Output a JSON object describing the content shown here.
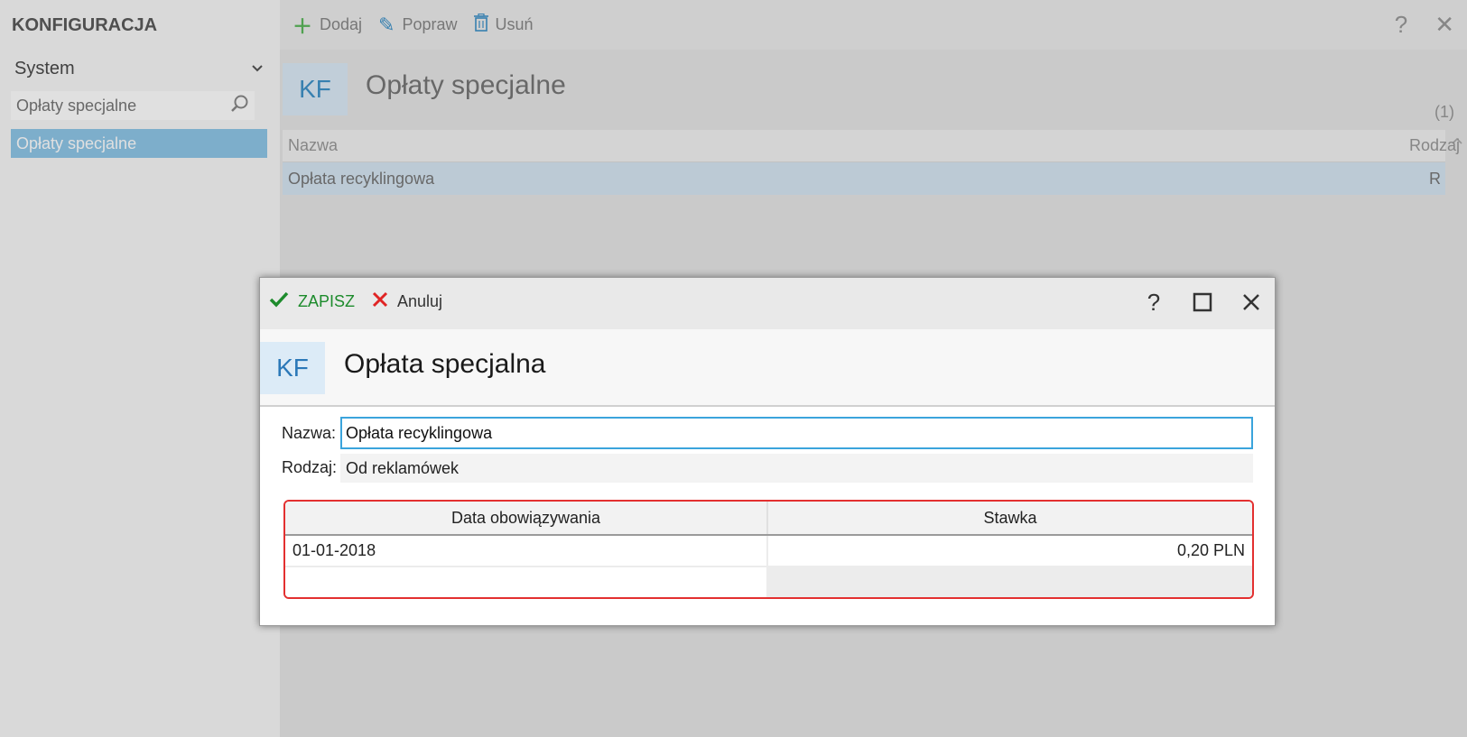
{
  "sidebar": {
    "app_title": "KONFIGURACJA",
    "section_select": "System",
    "search_value": "Opłaty specjalne",
    "nav_items": [
      "Opłaty specjalne"
    ]
  },
  "toolbar": {
    "add_label": "Dodaj",
    "edit_label": "Popraw",
    "delete_label": "Usuń",
    "help_icon": "?",
    "close_icon": "✕"
  },
  "main": {
    "badge": "KF",
    "title": "Opłaty specjalne",
    "count": "(1)",
    "columns": [
      "Nazwa",
      "Rodzaj"
    ],
    "rows": [
      {
        "name": "Opłata recyklingowa",
        "kind": "R"
      }
    ]
  },
  "dialog": {
    "save_label": "ZAPISZ",
    "cancel_label": "Anuluj",
    "help_icon": "?",
    "badge": "KF",
    "title": "Opłata specjalna",
    "name_label": "Nazwa:",
    "name_value": "Opłata recyklingowa",
    "kind_label": "Rodzaj:",
    "kind_value": "Od reklamówek",
    "rates": {
      "columns": [
        "Data obowiązywania",
        "Stawka"
      ],
      "rows": [
        {
          "date": "01-01-2018",
          "rate": "0,20 PLN"
        }
      ]
    }
  },
  "colors": {
    "accent": "#3ba4dc",
    "save": "#1d8b2c",
    "cancel_icon": "#e02424",
    "highlight_border": "#e33030",
    "sidebar_selected": "#8fc6e8"
  }
}
